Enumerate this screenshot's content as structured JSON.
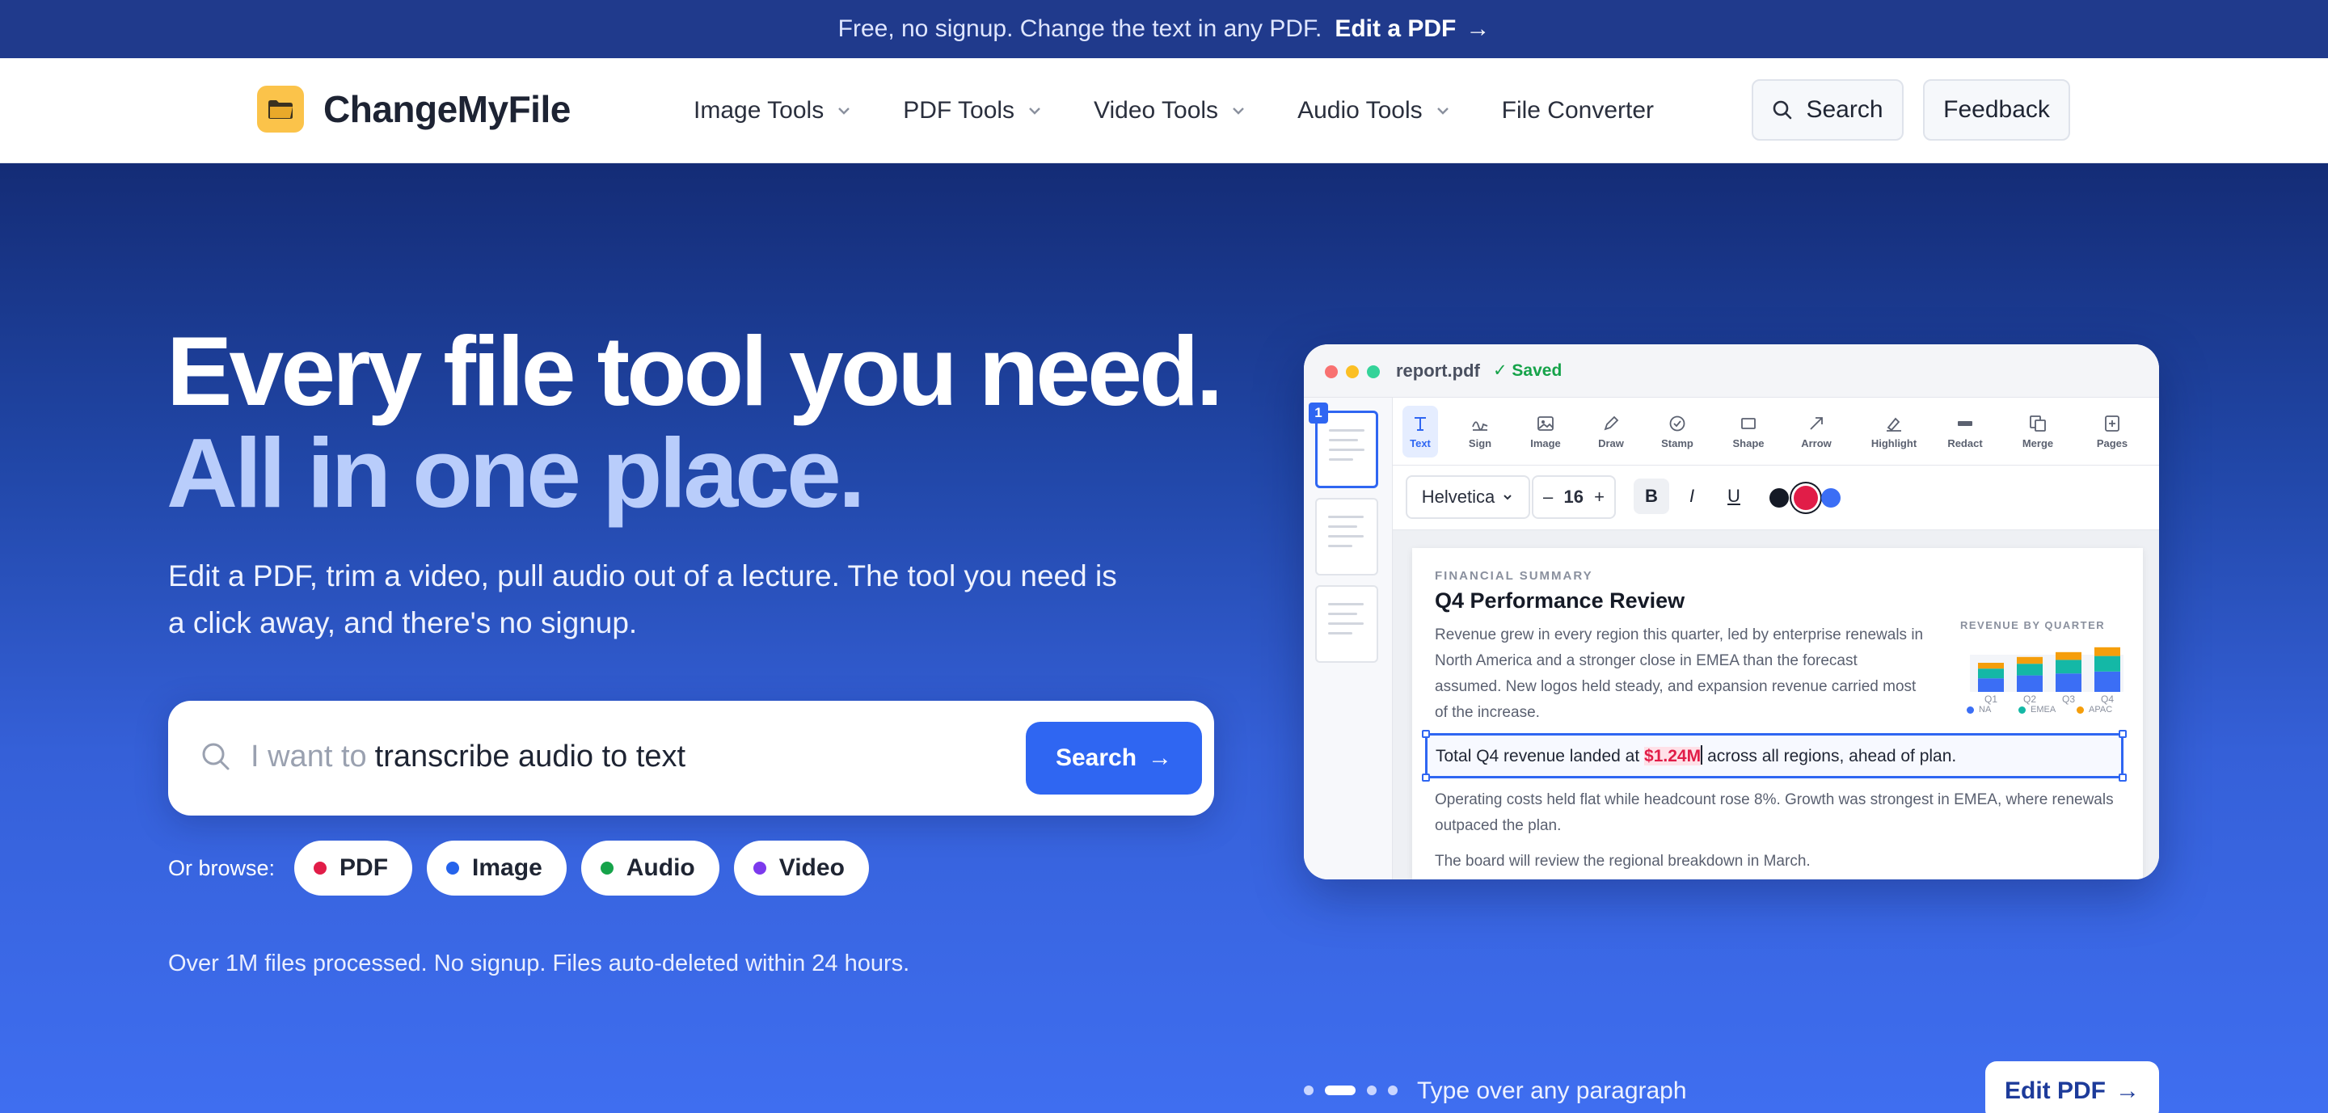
{
  "announce": {
    "text": "Free, no signup. Change the text in any PDF.",
    "cta": "Edit a PDF",
    "arrow": "→"
  },
  "brand": {
    "name": "ChangeMyFile",
    "icon": "folder-icon",
    "color": "#fbc34a"
  },
  "nav": {
    "items": [
      {
        "label": "Image Tools",
        "dropdown": true
      },
      {
        "label": "PDF Tools",
        "dropdown": true
      },
      {
        "label": "Video Tools",
        "dropdown": true
      },
      {
        "label": "Audio Tools",
        "dropdown": true
      },
      {
        "label": "File Converter",
        "dropdown": false
      }
    ],
    "search_label": "Search",
    "feedback_label": "Feedback"
  },
  "hero": {
    "title_line1": "Every file tool you need.",
    "title_line2": "All in one place.",
    "lede": "Edit a PDF, trim a video, pull audio out of a lecture. The tool you need is a click away, and there's no signup.",
    "search": {
      "prefix": "I want to",
      "query": "transcribe audio to text",
      "button": "Search",
      "arrow": "→"
    },
    "browse": {
      "label": "Or browse:",
      "chips": [
        {
          "label": "PDF",
          "color": "#e11d48"
        },
        {
          "label": "Image",
          "color": "#2563eb"
        },
        {
          "label": "Audio",
          "color": "#16a34a"
        },
        {
          "label": "Video",
          "color": "#7c3aed"
        }
      ]
    },
    "proof": "Over 1M files processed. No signup. Files auto-deleted within 24 hours."
  },
  "editor": {
    "filename": "report.pdf",
    "status": "✓ Saved",
    "page_badge": "1",
    "tools": [
      "Text",
      "Sign",
      "Image",
      "Draw",
      "Stamp",
      "Shape",
      "Arrow",
      "Highlight",
      "Redact",
      "Merge",
      "Pages"
    ],
    "active_tool": "Text",
    "font": "Helvetica",
    "font_size": "16",
    "format": {
      "bold": "B",
      "italic": "I",
      "underline": "U",
      "minus": "–",
      "plus": "+"
    },
    "swatches": [
      "#151a26",
      "#e11d48",
      "#3b6ef5"
    ],
    "doc": {
      "kicker": "FINANCIAL SUMMARY",
      "title": "Q4 Performance Review",
      "para1": "Revenue grew in every region this quarter, led by enterprise renewals in North America and a stronger close in EMEA than the forecast assumed. New logos held steady, and expansion revenue carried most of the increase.",
      "edit_before": "Total Q4 revenue landed at ",
      "edit_highlight": "$1.24M",
      "edit_after": "across all regions, ahead of plan.",
      "para2": "Operating costs held flat while headcount rose 8%. Growth was strongest in EMEA, where renewals outpaced the plan.",
      "para3": "The board will review the regional breakdown in March."
    }
  },
  "chart_data": {
    "type": "bar",
    "title": "REVENUE BY QUARTER",
    "stacked": true,
    "categories": [
      "Q1",
      "Q2",
      "Q3",
      "Q4"
    ],
    "series": [
      {
        "name": "NA",
        "color": "#3b6ef5",
        "values": [
          14,
          17,
          19,
          21
        ]
      },
      {
        "name": "EMEA",
        "color": "#14b8a6",
        "values": [
          10,
          12,
          14,
          16
        ]
      },
      {
        "name": "APAC",
        "color": "#f59e0b",
        "values": [
          6,
          7,
          8,
          9
        ]
      }
    ],
    "ylim": [
      0,
      50
    ],
    "grid": false,
    "legend": "bottom"
  },
  "carousel": {
    "caption": "Type over any paragraph",
    "slides": 4,
    "active": 1,
    "button": "Edit PDF",
    "arrow": "→"
  }
}
